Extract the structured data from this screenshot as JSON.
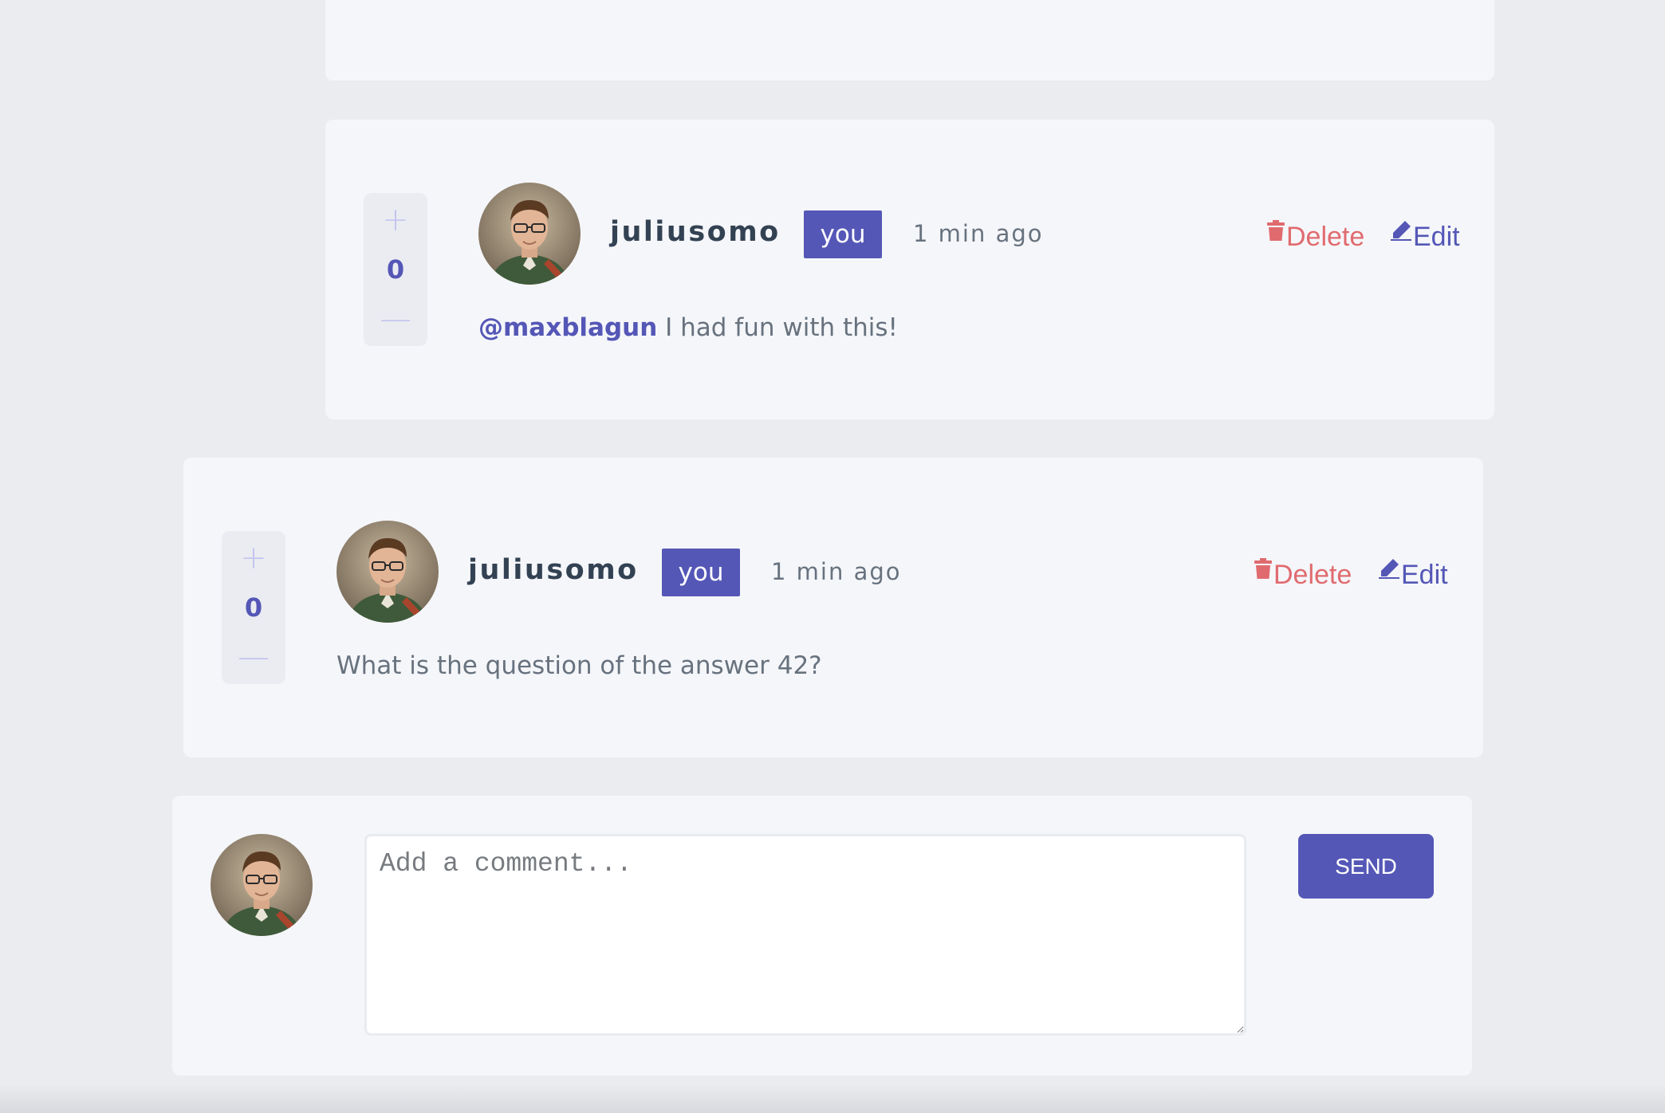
{
  "colors": {
    "accent": "#5457b6",
    "danger": "#e06b6f",
    "background": "#ebecf0",
    "card": "#f5f6fa"
  },
  "replies": [
    {
      "score": "0",
      "username": "juliusomo",
      "badge": "you",
      "time": "1 min ago",
      "delete_label": "Delete",
      "edit_label": "Edit",
      "mention": "@maxblagun",
      "text": " I had fun with this!"
    }
  ],
  "comments": [
    {
      "score": "0",
      "username": "juliusomo",
      "badge": "you",
      "time": "1 min ago",
      "delete_label": "Delete",
      "edit_label": "Edit",
      "text": "What is the question of the answer 42?"
    }
  ],
  "composer": {
    "placeholder": "Add a comment...",
    "send_label": "SEND"
  },
  "icons": {
    "upvote": "plus-icon",
    "downvote": "minus-icon",
    "delete": "trash-icon",
    "edit": "pencil-icon"
  }
}
